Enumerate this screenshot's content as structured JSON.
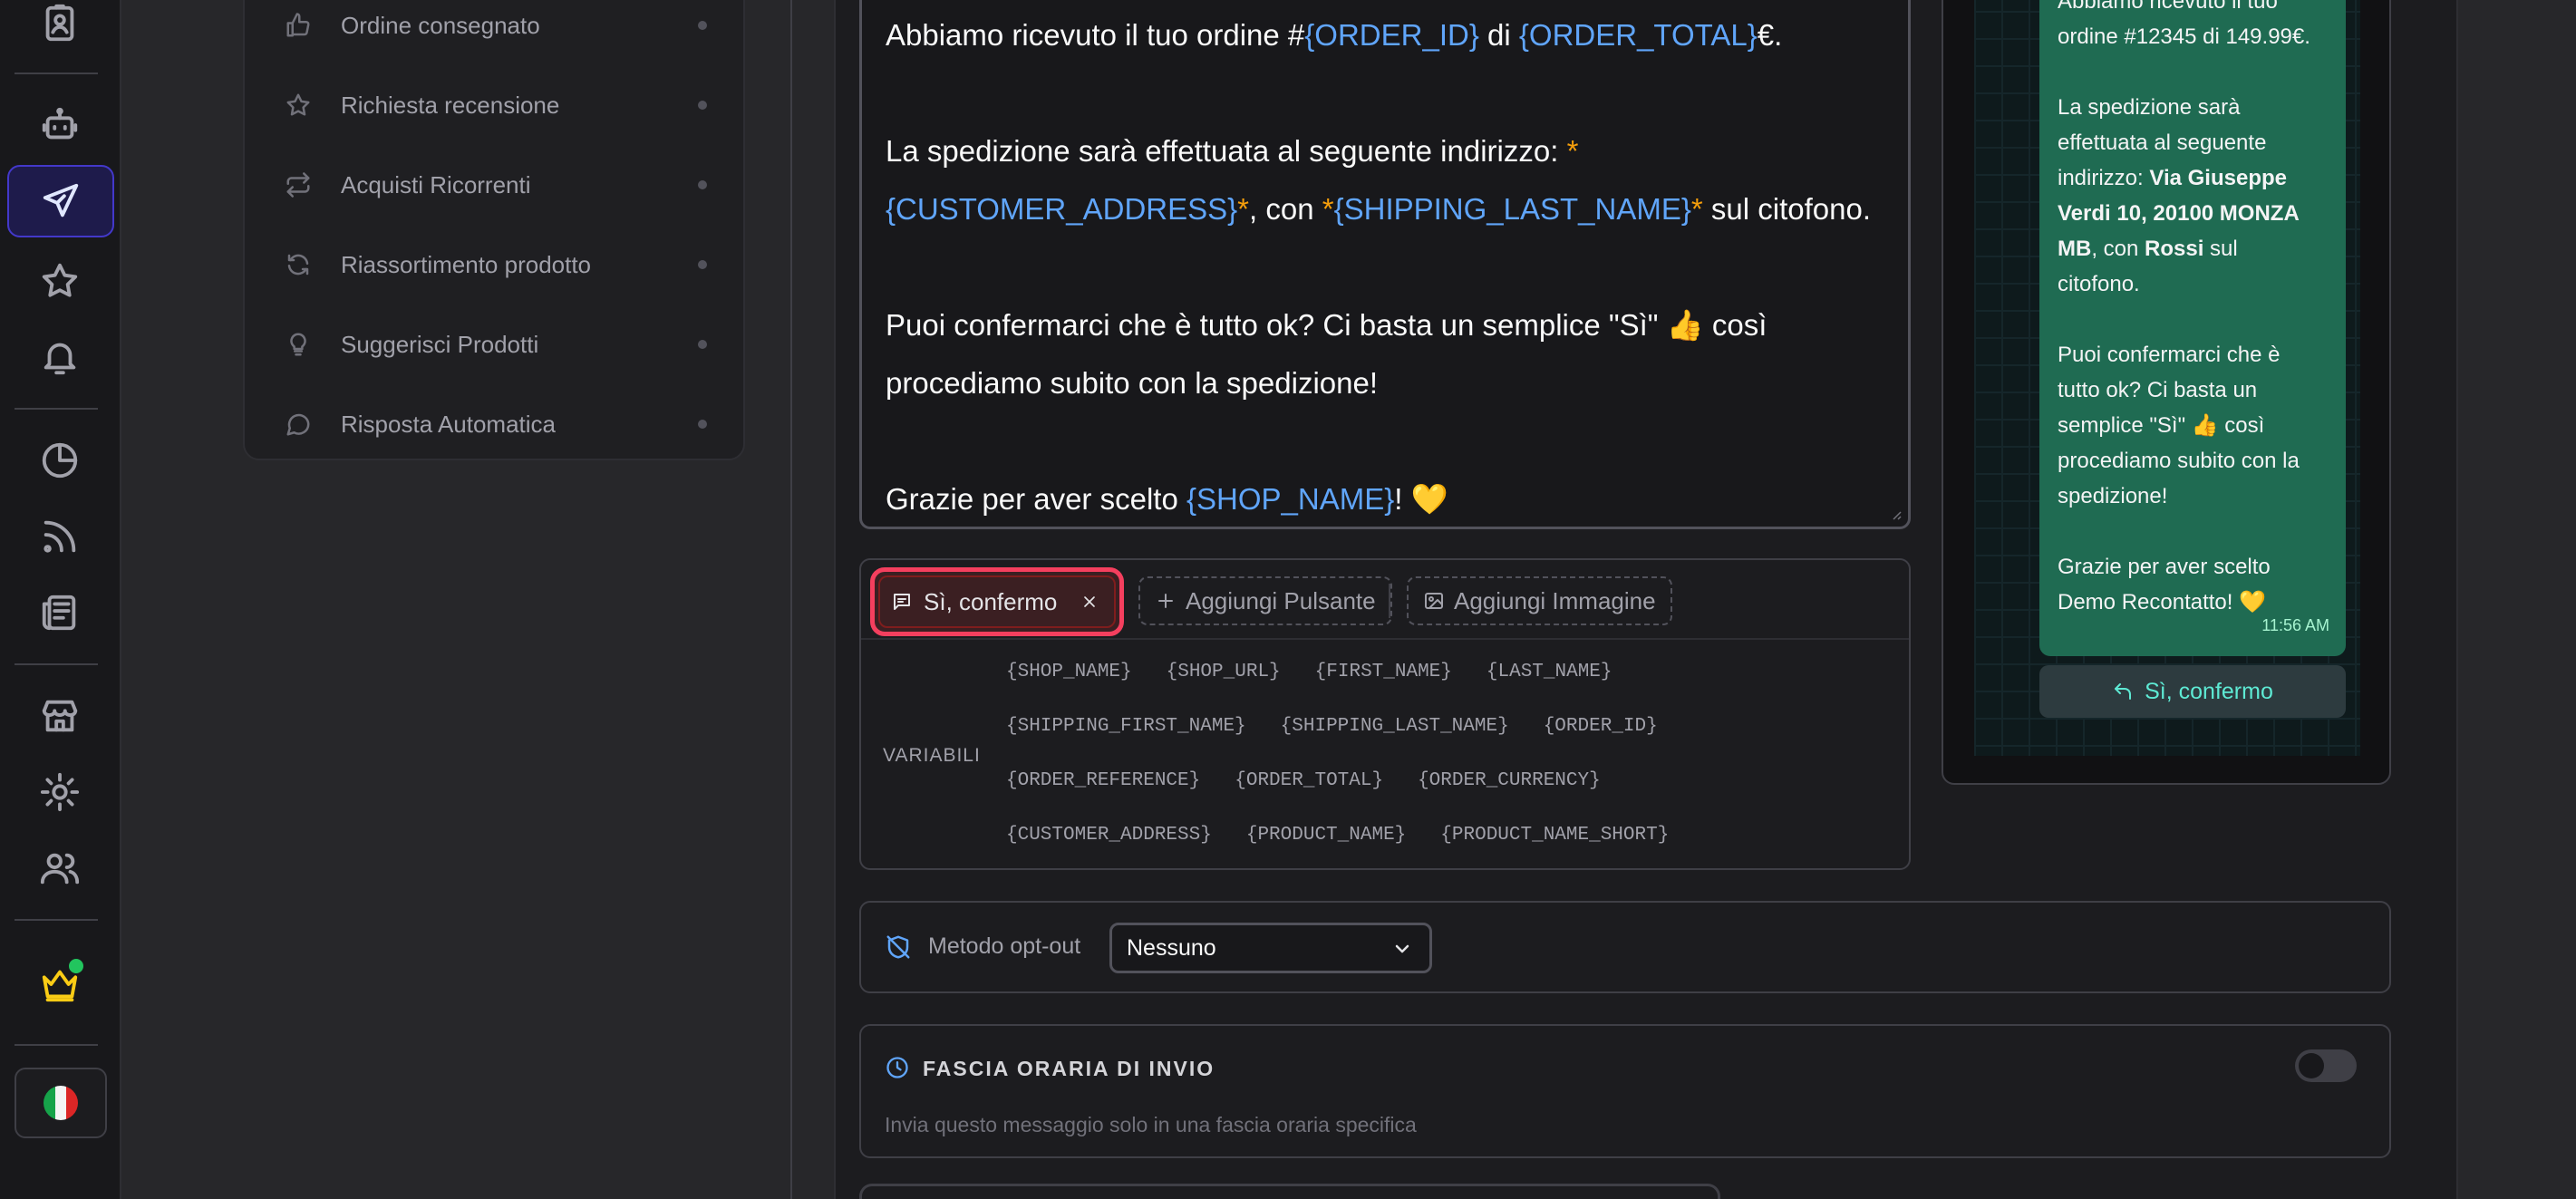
{
  "menu": {
    "items": [
      {
        "label": "Ordine consegnato",
        "icon": "thumbs-up-icon"
      },
      {
        "label": "Richiesta recensione",
        "icon": "star-icon"
      },
      {
        "label": "Acquisti Ricorrenti",
        "icon": "repeat-icon"
      },
      {
        "label": "Riassortimento prodotto",
        "icon": "refresh-icon"
      },
      {
        "label": "Suggerisci Prodotti",
        "icon": "lightbulb-icon"
      },
      {
        "label": "Risposta Automatica",
        "icon": "message-icon"
      }
    ]
  },
  "editor": {
    "line1_prefix": "Abbiamo ricevuto il tuo ordine #",
    "var_order_id": "{ORDER_ID}",
    "line1_mid": " di ",
    "var_order_total": "{ORDER_TOTAL}",
    "line1_suffix": "€.",
    "line2": "La spedizione sarà effettuata al seguente indirizzo: ",
    "var_customer_address": "{CUSTOMER_ADDRESS}",
    "line3_mid": ", con ",
    "var_shipping_last_name": "{SHIPPING_LAST_NAME}",
    "line3_suffix": " sul citofono.",
    "line4": "Puoi confermarci che è tutto ok? Ci basta un semplice \"Sì\" 👍 così",
    "line5": "procediamo subito con la spedizione!",
    "line6_prefix": "Grazie per aver scelto ",
    "var_shop_name": "{SHOP_NAME}",
    "line6_suffix": "! 💛",
    "bold_marker": "*"
  },
  "buttons": {
    "active_chip": "Sì, confermo",
    "add_button": "Aggiungi Pulsante",
    "add_image": "Aggiungi Immagine"
  },
  "variables": {
    "label": "VARIABILI",
    "rows": [
      [
        "{SHOP_NAME}",
        "{SHOP_URL}",
        "{FIRST_NAME}",
        "{LAST_NAME}"
      ],
      [
        "{SHIPPING_FIRST_NAME}",
        "{SHIPPING_LAST_NAME}",
        "{ORDER_ID}"
      ],
      [
        "{ORDER_REFERENCE}",
        "{ORDER_TOTAL}",
        "{ORDER_CURRENCY}"
      ],
      [
        "{CUSTOMER_ADDRESS}",
        "{PRODUCT_NAME}",
        "{PRODUCT_NAME_SHORT}"
      ]
    ]
  },
  "preview": {
    "line1": "Abbiamo ricevuto il tuo",
    "line2": "ordine #12345 di 149.99€.",
    "line3": "La spedizione sarà",
    "line4": "effettuata al seguente",
    "line5_prefix": "indirizzo: ",
    "line5_bold": "Via Giuseppe",
    "line6_bold": "Verdi 10, 20100 MONZA",
    "line7_bold": "MB",
    "line7_mid": ", con ",
    "line7_bold2": "Rossi",
    "line7_suffix": " sul",
    "line8": "citofono.",
    "line9": "Puoi confermarci che è",
    "line10": "tutto ok? Ci basta un",
    "line11": "semplice \"Sì\" 👍 così",
    "line12": "procediamo subito con la",
    "line13": "spedizione!",
    "line14": "Grazie per aver scelto",
    "line15": "Demo Recontatto! 💛",
    "time": "11:56 AM",
    "reply_button": "Sì, confermo"
  },
  "optout": {
    "label": "Metodo opt-out",
    "selected": "Nessuno"
  },
  "time_slot": {
    "title": "FASCIA ORARIA DI INVIO",
    "description": "Invia questo messaggio solo in una fascia oraria specifica",
    "enabled": false
  },
  "colors": {
    "accent_blue": "#60a5fa",
    "bold_marker": "#f59e0b",
    "active_chip_border": "#f43f5e",
    "bubble_green": "#1f6b52",
    "crown": "#facc15",
    "online_dot": "#22c55e"
  }
}
